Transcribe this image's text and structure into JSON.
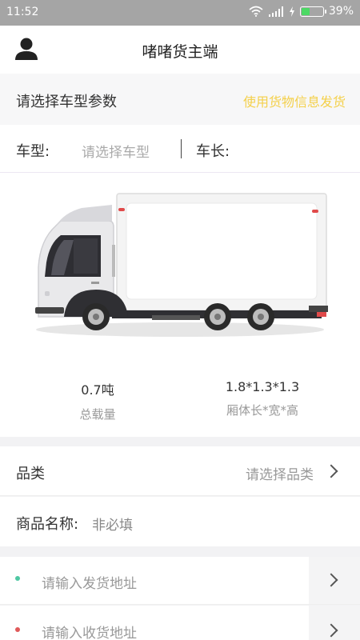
{
  "status_bar": {
    "time": "11:52",
    "battery_percent": "39%",
    "battery_level": 0.39
  },
  "header": {
    "title": "啫啫货主端",
    "avatar_icon": "user-icon"
  },
  "section": {
    "title": "请选择车型参数",
    "link": "使用货物信息发货",
    "link_color": "#f4d04a"
  },
  "vehicle": {
    "type_label": "车型:",
    "type_placeholder": "请选择车型",
    "length_label": "车长:"
  },
  "specs": [
    {
      "value": "0.7吨",
      "label": "总载量"
    },
    {
      "value": "1.8*1.3*1.3",
      "label": "厢体长*宽*高"
    }
  ],
  "category": {
    "label": "品类",
    "value": "请选择品类"
  },
  "goods_name": {
    "label": "商品名称:",
    "value": "非必填"
  },
  "addresses": [
    {
      "placeholder": "请输入发货地址",
      "dot_color": "#4fc7a3"
    },
    {
      "placeholder": "请输入收货地址",
      "dot_color": "#e05a5a"
    }
  ]
}
